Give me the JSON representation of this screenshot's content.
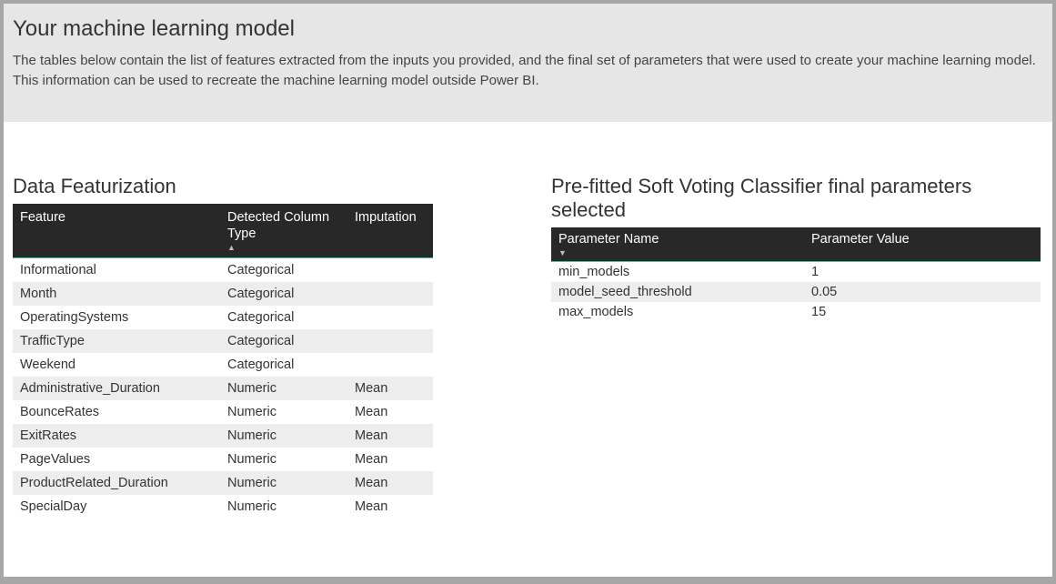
{
  "header": {
    "title": "Your machine learning model",
    "description": "The tables below contain the list of features extracted from the inputs you provided, and the final set of parameters that were used to create your machine learning model.  This information can be used to recreate the machine learning model outside Power BI."
  },
  "featurization": {
    "title": "Data Featurization",
    "columns": [
      "Feature",
      "Detected Column Type",
      "Imputation"
    ],
    "rows": [
      {
        "feature": "Informational",
        "type": "Categorical",
        "imputation": ""
      },
      {
        "feature": "Month",
        "type": "Categorical",
        "imputation": ""
      },
      {
        "feature": "OperatingSystems",
        "type": "Categorical",
        "imputation": ""
      },
      {
        "feature": "TrafficType",
        "type": "Categorical",
        "imputation": ""
      },
      {
        "feature": "Weekend",
        "type": "Categorical",
        "imputation": ""
      },
      {
        "feature": "Administrative_Duration",
        "type": "Numeric",
        "imputation": "Mean"
      },
      {
        "feature": "BounceRates",
        "type": "Numeric",
        "imputation": "Mean"
      },
      {
        "feature": "ExitRates",
        "type": "Numeric",
        "imputation": "Mean"
      },
      {
        "feature": "PageValues",
        "type": "Numeric",
        "imputation": "Mean"
      },
      {
        "feature": "ProductRelated_Duration",
        "type": "Numeric",
        "imputation": "Mean"
      },
      {
        "feature": "SpecialDay",
        "type": "Numeric",
        "imputation": "Mean"
      }
    ]
  },
  "parameters": {
    "title": "Pre-fitted Soft Voting Classifier final parameters selected",
    "columns": [
      "Parameter Name",
      "Parameter Value"
    ],
    "rows": [
      {
        "name": "min_models",
        "value": "1"
      },
      {
        "name": "model_seed_threshold",
        "value": "0.05"
      },
      {
        "name": "max_models",
        "value": "15"
      }
    ]
  }
}
